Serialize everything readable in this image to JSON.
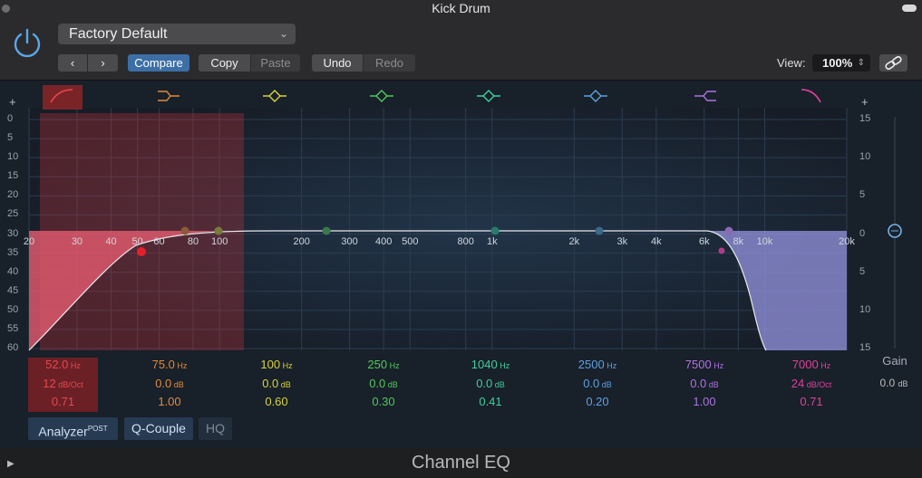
{
  "window": {
    "title": "Kick Drum"
  },
  "header": {
    "preset": "Factory Default",
    "prev_label": "‹",
    "next_label": "›",
    "compare_label": "Compare",
    "copy_label": "Copy",
    "paste_label": "Paste",
    "undo_label": "Undo",
    "redo_label": "Redo",
    "view_label": "View:",
    "view_value": "100%"
  },
  "graph": {
    "db_scale_left": [
      "0",
      "5",
      "10",
      "15",
      "20",
      "25",
      "30",
      "35",
      "40",
      "45",
      "50",
      "55",
      "60"
    ],
    "db_scale_right": [
      "15",
      "10",
      "5",
      "0",
      "5",
      "10",
      "15"
    ],
    "freq_labels": [
      "20",
      "30",
      "40",
      "50",
      "60",
      "80",
      "100",
      "200",
      "300",
      "400",
      "500",
      "800",
      "1k",
      "2k",
      "3k",
      "4k",
      "6k",
      "8k",
      "10k",
      "20k"
    ],
    "plus_left": "+",
    "plus_right": "+"
  },
  "bands": [
    {
      "freq": "52.0",
      "freq_unit": "Hz",
      "gain": "12",
      "gain_unit": "dB/Oct",
      "q": "0.71",
      "color": "#e5484d",
      "type": "low-cut",
      "active": true
    },
    {
      "freq": "75.0",
      "freq_unit": "Hz",
      "gain": "0.0",
      "gain_unit": "dB",
      "q": "1.00",
      "color": "#e08a3a",
      "type": "low-shelf"
    },
    {
      "freq": "100",
      "freq_unit": "Hz",
      "gain": "0.0",
      "gain_unit": "dB",
      "q": "0.60",
      "color": "#d8d23a",
      "type": "peak"
    },
    {
      "freq": "250",
      "freq_unit": "Hz",
      "gain": "0.0",
      "gain_unit": "dB",
      "q": "0.30",
      "color": "#4fc85a",
      "type": "peak"
    },
    {
      "freq": "1040",
      "freq_unit": "Hz",
      "gain": "0.0",
      "gain_unit": "dB",
      "q": "0.41",
      "color": "#3fcf9c",
      "type": "peak"
    },
    {
      "freq": "2500",
      "freq_unit": "Hz",
      "gain": "0.0",
      "gain_unit": "dB",
      "q": "0.20",
      "color": "#5ea0e0",
      "type": "peak"
    },
    {
      "freq": "7500",
      "freq_unit": "Hz",
      "gain": "0.0",
      "gain_unit": "dB",
      "q": "1.00",
      "color": "#b072e0",
      "type": "high-shelf"
    },
    {
      "freq": "7000",
      "freq_unit": "Hz",
      "gain": "24",
      "gain_unit": "dB/Oct",
      "q": "0.71",
      "color": "#e0409a",
      "type": "high-cut"
    }
  ],
  "gain": {
    "label": "Gain",
    "value": "0.0",
    "unit": "dB"
  },
  "bottom": {
    "analyzer_label": "Analyzer",
    "analyzer_sup": "POST",
    "qcouple_label": "Q-Couple",
    "hq_label": "HQ"
  },
  "footer": {
    "plugin_name": "Channel EQ"
  }
}
